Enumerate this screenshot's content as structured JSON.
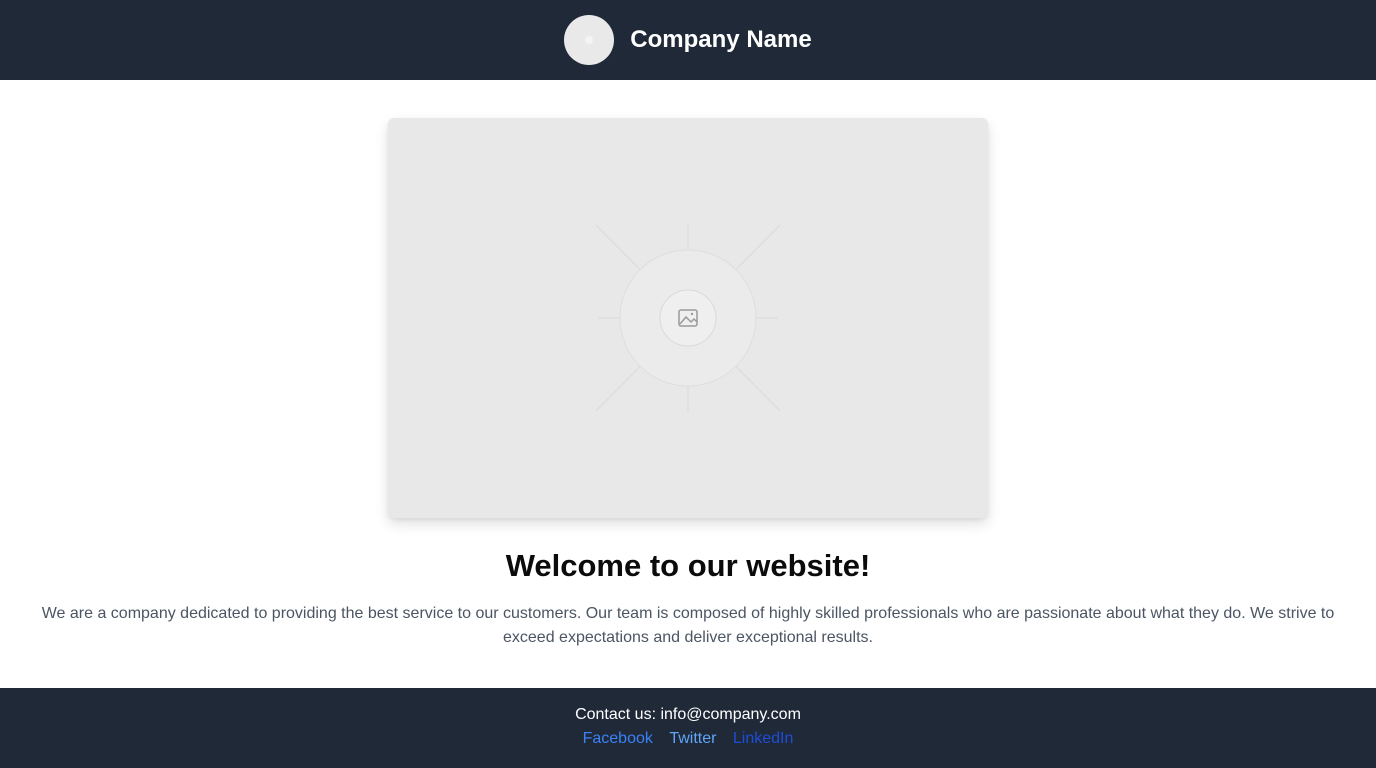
{
  "header": {
    "company_name": "Company Name"
  },
  "hero": {
    "image_icon": "image-placeholder-icon"
  },
  "main": {
    "heading": "Welcome to our website!",
    "intro": "We are a company dedicated to providing the best service to our customers. Our team is composed of highly skilled professionals who are passionate about what they do. We strive to exceed expectations and deliver exceptional results."
  },
  "footer": {
    "contact": "Contact us: info@company.com",
    "social": {
      "facebook": "Facebook",
      "twitter": "Twitter",
      "linkedin": "LinkedIn"
    }
  },
  "colors": {
    "header_bg": "#1f2937",
    "footer_bg": "#1f2937",
    "link_facebook": "#3b82f6",
    "link_twitter": "#60a5fa",
    "link_linkedin": "#1d4ed8"
  }
}
